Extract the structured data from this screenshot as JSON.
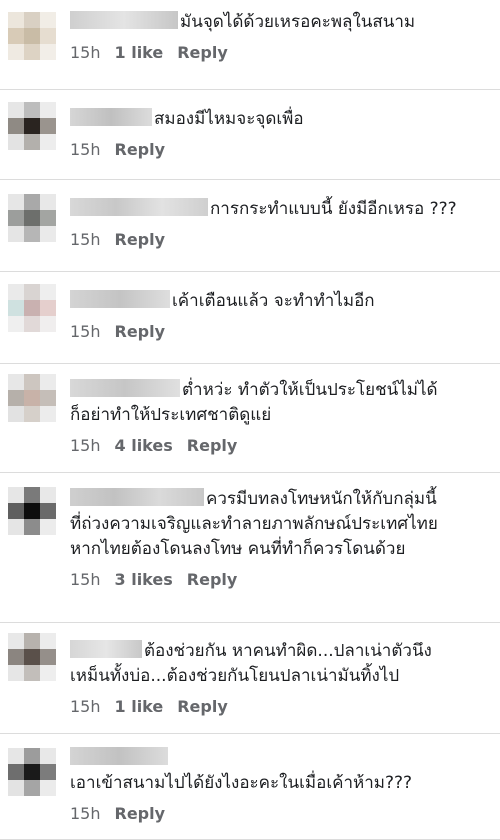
{
  "comments": [
    {
      "text_lines": [
        "มันจุดได้ด้วยเหรอคะพลุในสนาม"
      ],
      "time": "15h",
      "likes": "1 like",
      "reply": "Reply",
      "avatar": [
        "#ece6dc",
        "#d9d0c3",
        "#f1ede6",
        "#d8cbb7",
        "#c9bca6",
        "#e6ddd0",
        "#efeae2",
        "#ddd3c4",
        "#f2eee8"
      ]
    },
    {
      "text_lines": [
        "สมองมีไหมจะจุดเพื่อ"
      ],
      "time": "15h",
      "likes": "",
      "reply": "Reply",
      "avatar": [
        "#e6e6e6",
        "#bdbdbd",
        "#ececec",
        "#8f8a84",
        "#2a2420",
        "#9a948e",
        "#e3e3e3",
        "#b3b0ac",
        "#ededed"
      ]
    },
    {
      "text_lines": [
        "การกระทำแบบนี้ ยังมีอีกเหรอ ???"
      ],
      "time": "15h",
      "likes": "",
      "reply": "Reply",
      "avatar": [
        "#e6e6e6",
        "#a9a9a9",
        "#e8e8e8",
        "#9c9e9c",
        "#6d6f6c",
        "#a3a5a2",
        "#e5e5e5",
        "#b6b6b6",
        "#eaeaea"
      ]
    },
    {
      "text_lines": [
        "เค้าเตือนแล้ว จะทำทำไมอีก"
      ],
      "time": "15h",
      "likes": "",
      "reply": "Reply",
      "avatar": [
        "#eaeaea",
        "#d9d4d2",
        "#eeeeee",
        "#cfe1e0",
        "#c9b1b0",
        "#e5cfcd",
        "#efefef",
        "#e1d9d8",
        "#f0eeee"
      ]
    },
    {
      "text_lines": [
        "ต่ำหว่ะ ทำตัวให้เป็นประโยชน์ไม่ได้",
        "ก็อย่าทำให้ประเทศชาติดูแย่"
      ],
      "time": "15h",
      "likes": "4 likes",
      "reply": "Reply",
      "avatar": [
        "#e7e7e7",
        "#cdc6c0",
        "#ebebeb",
        "#b6b0aa",
        "#c8b2a8",
        "#c5beb8",
        "#e2e2e2",
        "#d6d0ca",
        "#ececec"
      ]
    },
    {
      "text_lines": [
        "ควรมีบทลงโทษหนักให้กับกลุ่มนี้",
        "ที่ถ่วงความเจริญและทำลายภาพลักษณ์ประเทศไทย",
        "หากไทยต้องโดนลงโทษ คนที่ทำก็ควรโดนด้วย"
      ],
      "time": "15h",
      "likes": "3 likes",
      "reply": "Reply",
      "avatar": [
        "#e6e6e6",
        "#7a7a7a",
        "#e8e8e8",
        "#5f5f5f",
        "#0d0d0d",
        "#6a6a6a",
        "#e5e5e5",
        "#8c8c8c",
        "#ececec"
      ]
    },
    {
      "text_lines": [
        "ต้องช่วยกัน หาคนทำผิด...ปลาเน่าตัวนึง",
        "เหม็นทั้งบ่อ...ต้องช่วยกันโยนปลาเน่ามันทิ้งไป"
      ],
      "time": "15h",
      "likes": "1 like",
      "reply": "Reply",
      "avatar": [
        "#e8e8e8",
        "#b7b2ad",
        "#ececec",
        "#8b8580",
        "#5a504a",
        "#958f8a",
        "#e6e6e6",
        "#c2beba",
        "#eeeeee"
      ]
    },
    {
      "text_lines": [
        "เอาเข้าสนามไปได้ยังไงอะคะในเมื่อเค้าห้าม???"
      ],
      "time": "15h",
      "likes": "",
      "reply": "Reply",
      "avatar": [
        "#e6e6e6",
        "#9c9c9c",
        "#e8e8e8",
        "#6e6e6e",
        "#1a1a1a",
        "#7c7c7c",
        "#e3e3e3",
        "#a5a5a5",
        "#ebebeb"
      ]
    }
  ]
}
